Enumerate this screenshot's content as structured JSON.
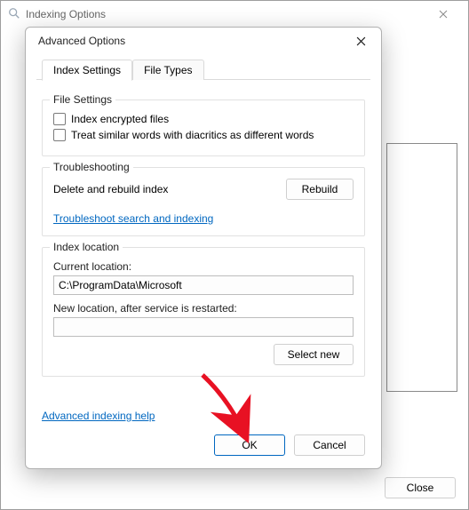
{
  "parentWindow": {
    "title": "Indexing Options",
    "closeButtonLabel": "Close"
  },
  "dialog": {
    "title": "Advanced Options",
    "tabs": [
      {
        "label": "Index Settings"
      },
      {
        "label": "File Types"
      }
    ],
    "fileSettings": {
      "legend": "File Settings",
      "checkbox1": "Index encrypted files",
      "checkbox2": "Treat similar words with diacritics as different words"
    },
    "troubleshooting": {
      "legend": "Troubleshooting",
      "text": "Delete and rebuild index",
      "rebuildButton": "Rebuild",
      "link": "Troubleshoot search and indexing"
    },
    "indexLocation": {
      "legend": "Index location",
      "currentLabel": "Current location:",
      "currentValue": "C:\\ProgramData\\Microsoft",
      "newLabel": "New location, after service is restarted:",
      "newValue": "",
      "selectNewButton": "Select new"
    },
    "helpLink": "Advanced indexing help",
    "okButton": "OK",
    "cancelButton": "Cancel"
  }
}
